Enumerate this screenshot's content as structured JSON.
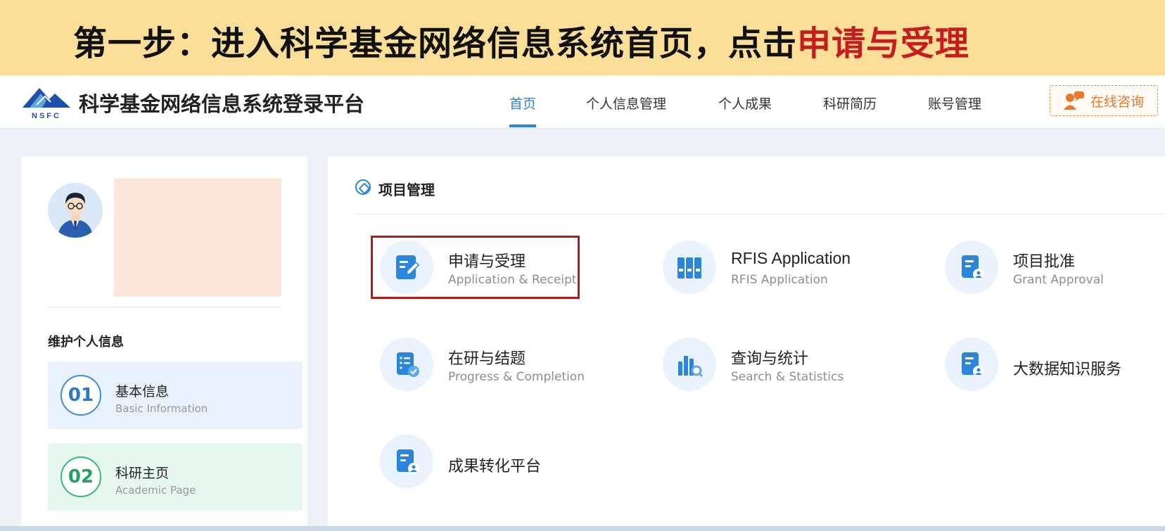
{
  "banner": {
    "prefix": "第一步：进入科学基金网络信息系统首页，点击",
    "highlight": "申请与受理"
  },
  "header": {
    "logo_text": "NSFC",
    "brand": "科学基金网络信息系统登录平台",
    "nav": [
      "首页",
      "个人信息管理",
      "个人成果",
      "科研简历",
      "账号管理"
    ],
    "active_nav": "首页",
    "consult_label": "在线咨询"
  },
  "sidebar": {
    "section_title": "维护个人信息",
    "cards": [
      {
        "num": "01",
        "zh": "基本信息",
        "en": "Basic Information"
      },
      {
        "num": "02",
        "zh": "科研主页",
        "en": "Academic Page"
      }
    ]
  },
  "main": {
    "section_title": "项目管理",
    "modules": [
      {
        "zh": "申请与受理",
        "en": "Application & Receipt",
        "icon": "edit-doc-icon"
      },
      {
        "zh": "RFIS Application",
        "en": "RFIS Application",
        "icon": "binders-icon"
      },
      {
        "zh": "项目批准",
        "en": "Grant Approval",
        "icon": "doc-user-icon"
      },
      {
        "zh": "在研与结题",
        "en": "Progress & Completion",
        "icon": "checklist-icon"
      },
      {
        "zh": "查询与统计",
        "en": "Search & Statistics",
        "icon": "chart-search-icon"
      },
      {
        "zh": "大数据知识服务",
        "en": "",
        "icon": "doc-user-icon"
      },
      {
        "zh": "成果转化平台",
        "en": "",
        "icon": "doc-user-icon"
      }
    ]
  },
  "colors": {
    "banner_bg": "#fbdf99",
    "highlight_red": "#c41d1d",
    "primary_blue": "#2b86d9",
    "consult_orange": "#e8782a",
    "box_red": "#b01c1c"
  }
}
